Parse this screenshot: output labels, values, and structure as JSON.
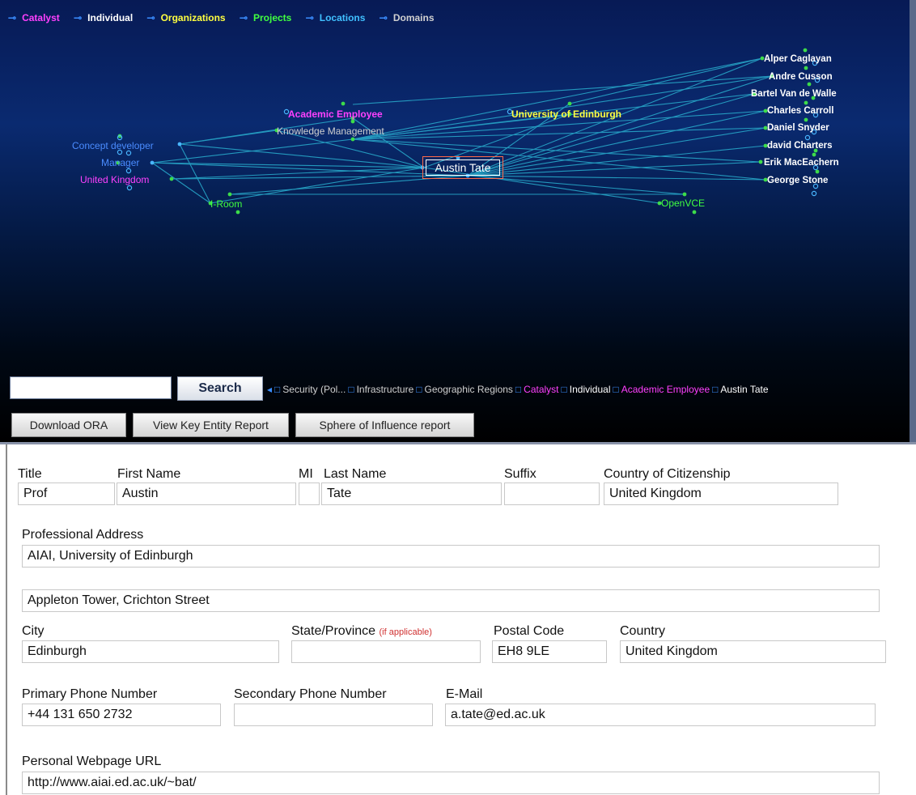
{
  "legend": [
    {
      "label": "Catalyst",
      "color": "#ff40ff"
    },
    {
      "label": "Individual",
      "color": "#ffffff"
    },
    {
      "label": "Organizations",
      "color": "#ffff40"
    },
    {
      "label": "Projects",
      "color": "#40ff40"
    },
    {
      "label": "Locations",
      "color": "#40c0ff"
    },
    {
      "label": "Domains",
      "color": "#d0d0d0"
    }
  ],
  "network": {
    "focus_label": "Austin Tate",
    "nodes": [
      {
        "label": "Alper  Caglayan",
        "color": "#ffffff"
      },
      {
        "label": "Andre Cusson",
        "color": "#ffffff"
      },
      {
        "label": "Bartel Van de Walle",
        "color": "#ffffff"
      },
      {
        "label": "Charles Carroll",
        "color": "#ffffff"
      },
      {
        "label": "Daniel Snyder",
        "color": "#ffffff"
      },
      {
        "label": "david Charters",
        "color": "#ffffff"
      },
      {
        "label": "Erik MacEachern",
        "color": "#ffffff"
      },
      {
        "label": "George Stone",
        "color": "#ffffff"
      },
      {
        "label": "Academic Employee",
        "color": "#ff40ff"
      },
      {
        "label": "University of Edinburgh",
        "color": "#ffff40"
      },
      {
        "label": "Knowledge Management",
        "color": "#d0d0d0"
      },
      {
        "label": "Concept developer",
        "color": "#4a8cff"
      },
      {
        "label": "Manager",
        "color": "#4a8cff"
      },
      {
        "label": "United Kingdom",
        "color": "#ff40ff"
      },
      {
        "label": "I-Room",
        "color": "#40ff40"
      },
      {
        "label": "OpenVCE",
        "color": "#40ff40"
      }
    ]
  },
  "search": {
    "placeholder": "",
    "button_label": "Search"
  },
  "breadcrumb": [
    {
      "label": "Security (Pol...",
      "color": "#d0d0d0"
    },
    {
      "label": "Infrastructure",
      "color": "#d0d0d0"
    },
    {
      "label": "Geographic Regions",
      "color": "#d0d0d0"
    },
    {
      "label": "Catalyst",
      "color": "#ff40ff"
    },
    {
      "label": "Individual",
      "color": "#ffffff"
    },
    {
      "label": "Academic Employee",
      "color": "#ff40ff"
    },
    {
      "label": "Austin Tate",
      "color": "#ffffff"
    }
  ],
  "actions": {
    "download": "Download ORA",
    "key_entity": "View Key Entity Report",
    "sphere": "Sphere of Influence report"
  },
  "form": {
    "title_label": "Title",
    "title_value": "Prof",
    "first_label": "First Name",
    "first_value": "Austin",
    "mi_label": "MI",
    "mi_value": "",
    "last_label": "Last Name",
    "last_value": "Tate",
    "suffix_label": "Suffix",
    "suffix_value": "",
    "citizenship_label": "Country of Citizenship",
    "citizenship_value": "United Kingdom",
    "address_label": "Professional Address",
    "address1_value": "AIAI, University of Edinburgh",
    "address2_value": "Appleton Tower, Crichton Street",
    "city_label": "City",
    "city_value": "Edinburgh",
    "state_label": "State/Province",
    "state_note": "(if applicable)",
    "state_value": "",
    "postal_label": "Postal Code",
    "postal_value": "EH8 9LE",
    "country_label": "Country",
    "country_value": "United Kingdom",
    "phone1_label": "Primary Phone Number",
    "phone1_value": "+44 131 650 2732",
    "phone2_label": "Secondary Phone Number",
    "phone2_value": "",
    "email_label": "E-Mail",
    "email_value": "a.tate@ed.ac.uk",
    "url_label": "Personal Webpage URL",
    "url_value": "http://www.aiai.ed.ac.uk/~bat/"
  }
}
